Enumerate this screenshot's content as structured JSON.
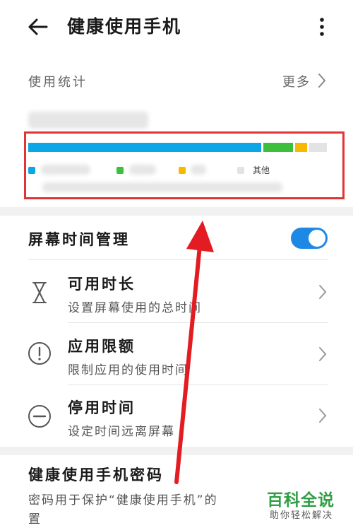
{
  "header": {
    "title": "健康使用手机"
  },
  "usage_stats": {
    "label": "使用统计",
    "more_label": "更多",
    "legend_other": "其他",
    "shares": [
      {
        "name": "app-1",
        "fraction": 0.78,
        "color": "#0aa6e6"
      },
      {
        "name": "app-2",
        "fraction": 0.1,
        "color": "#3cc03c"
      },
      {
        "name": "app-3",
        "fraction": 0.04,
        "color": "#f8b800"
      },
      {
        "name": "other",
        "fraction": 0.06,
        "color": "#e3e3e3"
      }
    ]
  },
  "screen_time": {
    "title": "屏幕时间管理",
    "toggle_on": true,
    "items": [
      {
        "title": "可用时长",
        "subtitle": "设置屏幕使用的总时间",
        "icon": "hourglass-icon"
      },
      {
        "title": "应用限额",
        "subtitle": "限制应用的使用时间",
        "icon": "alert-circle-icon"
      },
      {
        "title": "停用时间",
        "subtitle": "设定时间远离屏幕",
        "icon": "minus-circle-icon"
      }
    ]
  },
  "password": {
    "title": "健康使用手机密码",
    "description_line1": "密码用于保护“健康使用手机”的",
    "description_line2": "置"
  },
  "watermark": {
    "main": "百科全说",
    "sub": "助你轻松解决"
  },
  "colors": {
    "accent": "#1e88e5",
    "highlight_box": "#e03436",
    "annotation_arrow": "#e31c23"
  }
}
